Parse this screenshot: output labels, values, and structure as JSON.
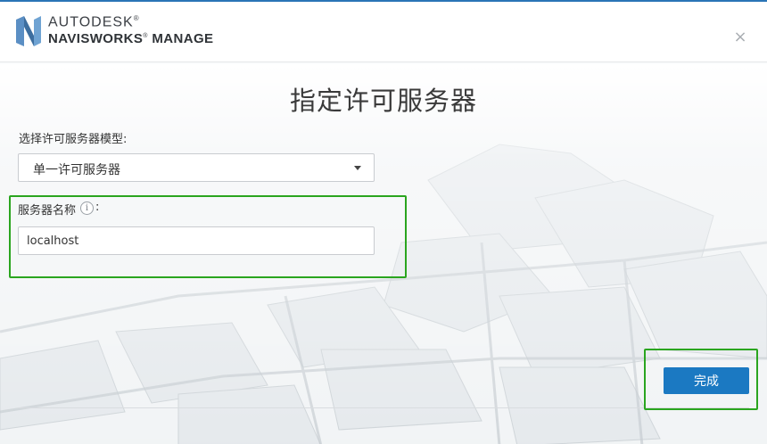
{
  "app": {
    "brand_top": "AUTODESK",
    "brand_product": "NAVISWORKS",
    "brand_edition": "MANAGE",
    "registered_mark": "®"
  },
  "dialog": {
    "title": "指定许可服务器",
    "close_glyph": "×"
  },
  "license_model": {
    "label": "选择许可服务器模型:",
    "selected": "单一许可服务器"
  },
  "server_name": {
    "label": "服务器名称",
    "info_glyph": "i",
    "colon": ":",
    "value": "localhost"
  },
  "actions": {
    "done_label": "完成"
  },
  "colors": {
    "accent": "#1b79c2",
    "highlight": "#2aa51f",
    "header_border": "#2a74b6"
  }
}
